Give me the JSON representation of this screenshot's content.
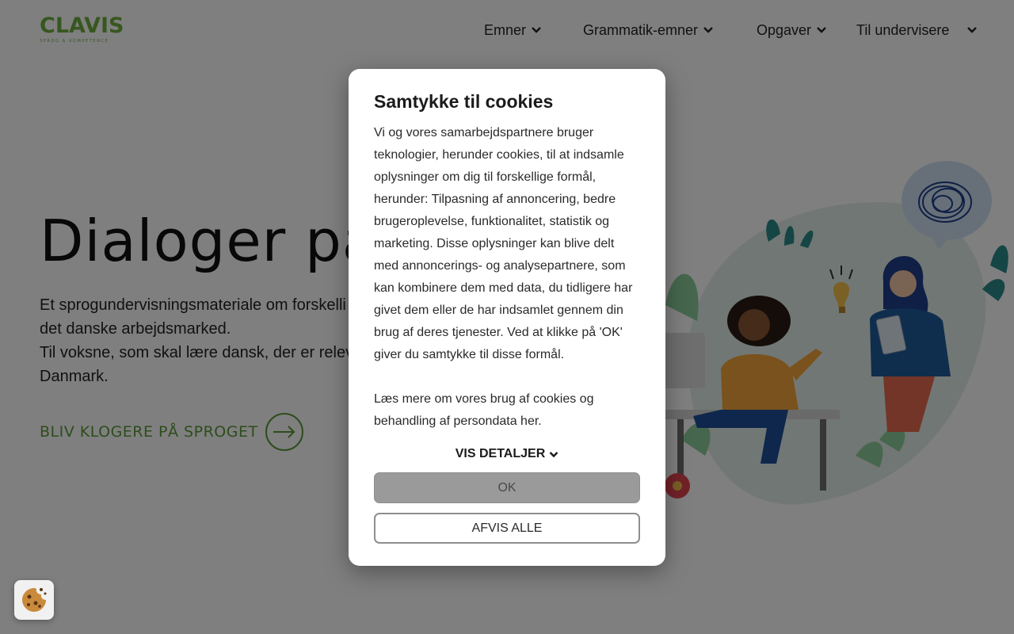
{
  "header": {
    "logo": {
      "name": "CLAVIS",
      "tagline": "SPROG & KOMPETENCE"
    },
    "nav": [
      {
        "label": "Emner"
      },
      {
        "label": "Grammatik-emner"
      },
      {
        "label": "Opgaver"
      },
      {
        "label": "Til undervisere"
      }
    ]
  },
  "hero": {
    "title": "Dialoger på",
    "description": [
      "Et sprogundervisningsmateriale om forskelli",
      "det danske arbejdsmarked.",
      "Til voksne, som skal lære dansk, der er relev",
      "Danmark."
    ],
    "cta_label": "BLIV KLOGERE PÅ SPROGET"
  },
  "cookie_dialog": {
    "title": "Samtykke til cookies",
    "body": "Vi og vores samarbejdspartnere bruger teknologier, herunder cookies, til at indsamle oplysninger om dig til forskellige formål, herunder: Tilpasning af annoncering, bedre brugeroplevelse, funktionalitet, statistik og marketing. Disse oplysninger kan blive delt med annoncerings- og analysepartnere, som kan kombinere dem med data, du tidligere har givet dem eller de har indsamlet gennem din brug af deres tjenester. Ved at klikke på 'OK' giver du samtykke til disse formål.",
    "read_more": "Læs mere om vores brug af cookies og behandling af persondata her.",
    "details_label": "VIS DETALJER",
    "ok_label": "OK",
    "reject_label": "AFVIS ALLE"
  },
  "icons": {
    "nav_chevron": "chevron-down-icon",
    "cta_arrow": "arrow-right-circle-icon",
    "cookie_settings": "cookie-icon"
  },
  "colors": {
    "brand_green": "#5b9b38",
    "overlay": "rgba(0,0,0,0.5)",
    "ok_button": "#9a9a9a"
  }
}
